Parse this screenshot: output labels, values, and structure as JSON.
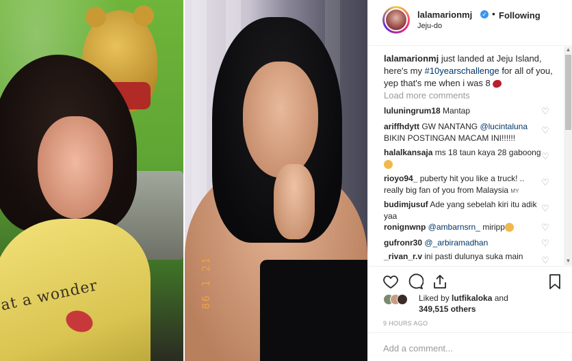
{
  "post": {
    "username": "lalamarionmj",
    "verified_icon": "verified-badge-icon",
    "separator": "•",
    "follow_status": "Following",
    "location": "Jeju-do"
  },
  "photo": {
    "left_shirt_text": "at a wonder",
    "right_film_date": "86 1 21"
  },
  "caption": {
    "username": "lalamarionmj",
    "text_before": " just landed at Jeju Island, here's my ",
    "hashtag": "#10yearschallenge",
    "text_after": " for all of you, yep that's me when i was 8 "
  },
  "load_more": "Load more comments",
  "comments": [
    {
      "user": "luluningrum18",
      "text": " Mantap"
    },
    {
      "user": "ariffhdytt",
      "text": " GW NANTANG ",
      "mention": "@lucintaluna",
      "text2": " BIKIN POSTINGAN MACAM INI!!!!!!"
    },
    {
      "user": "halalkansaja",
      "text": " ms 18 taun kaya 28 gaboong"
    },
    {
      "user": "rioyo94_",
      "text": " puberty hit you like a truck! .. really big fan of you from Malaysia ",
      "suffix": "MY"
    },
    {
      "user": "budimjusuf",
      "text": " Ade yang sebelah kiri itu adik yaa"
    },
    {
      "user": "ronignwnp",
      "mention": "@ambarnsrn_",
      "text": " miripp"
    },
    {
      "user": "gufronr30",
      "mention": "@_arbiramadhan",
      "text": ""
    },
    {
      "user": "_rivan_r.v",
      "text": " ini pasti dulunya suka main"
    }
  ],
  "likes": {
    "prefix": "Liked by ",
    "user": "lutfikaloka",
    "middle": " and",
    "count": "349,515 others"
  },
  "timestamp": "9 HOURS AGO",
  "add_comment": {
    "placeholder": "Add a comment..."
  },
  "colors": {
    "link": "#003569",
    "verified": "#3897f0",
    "muted": "#999999"
  }
}
